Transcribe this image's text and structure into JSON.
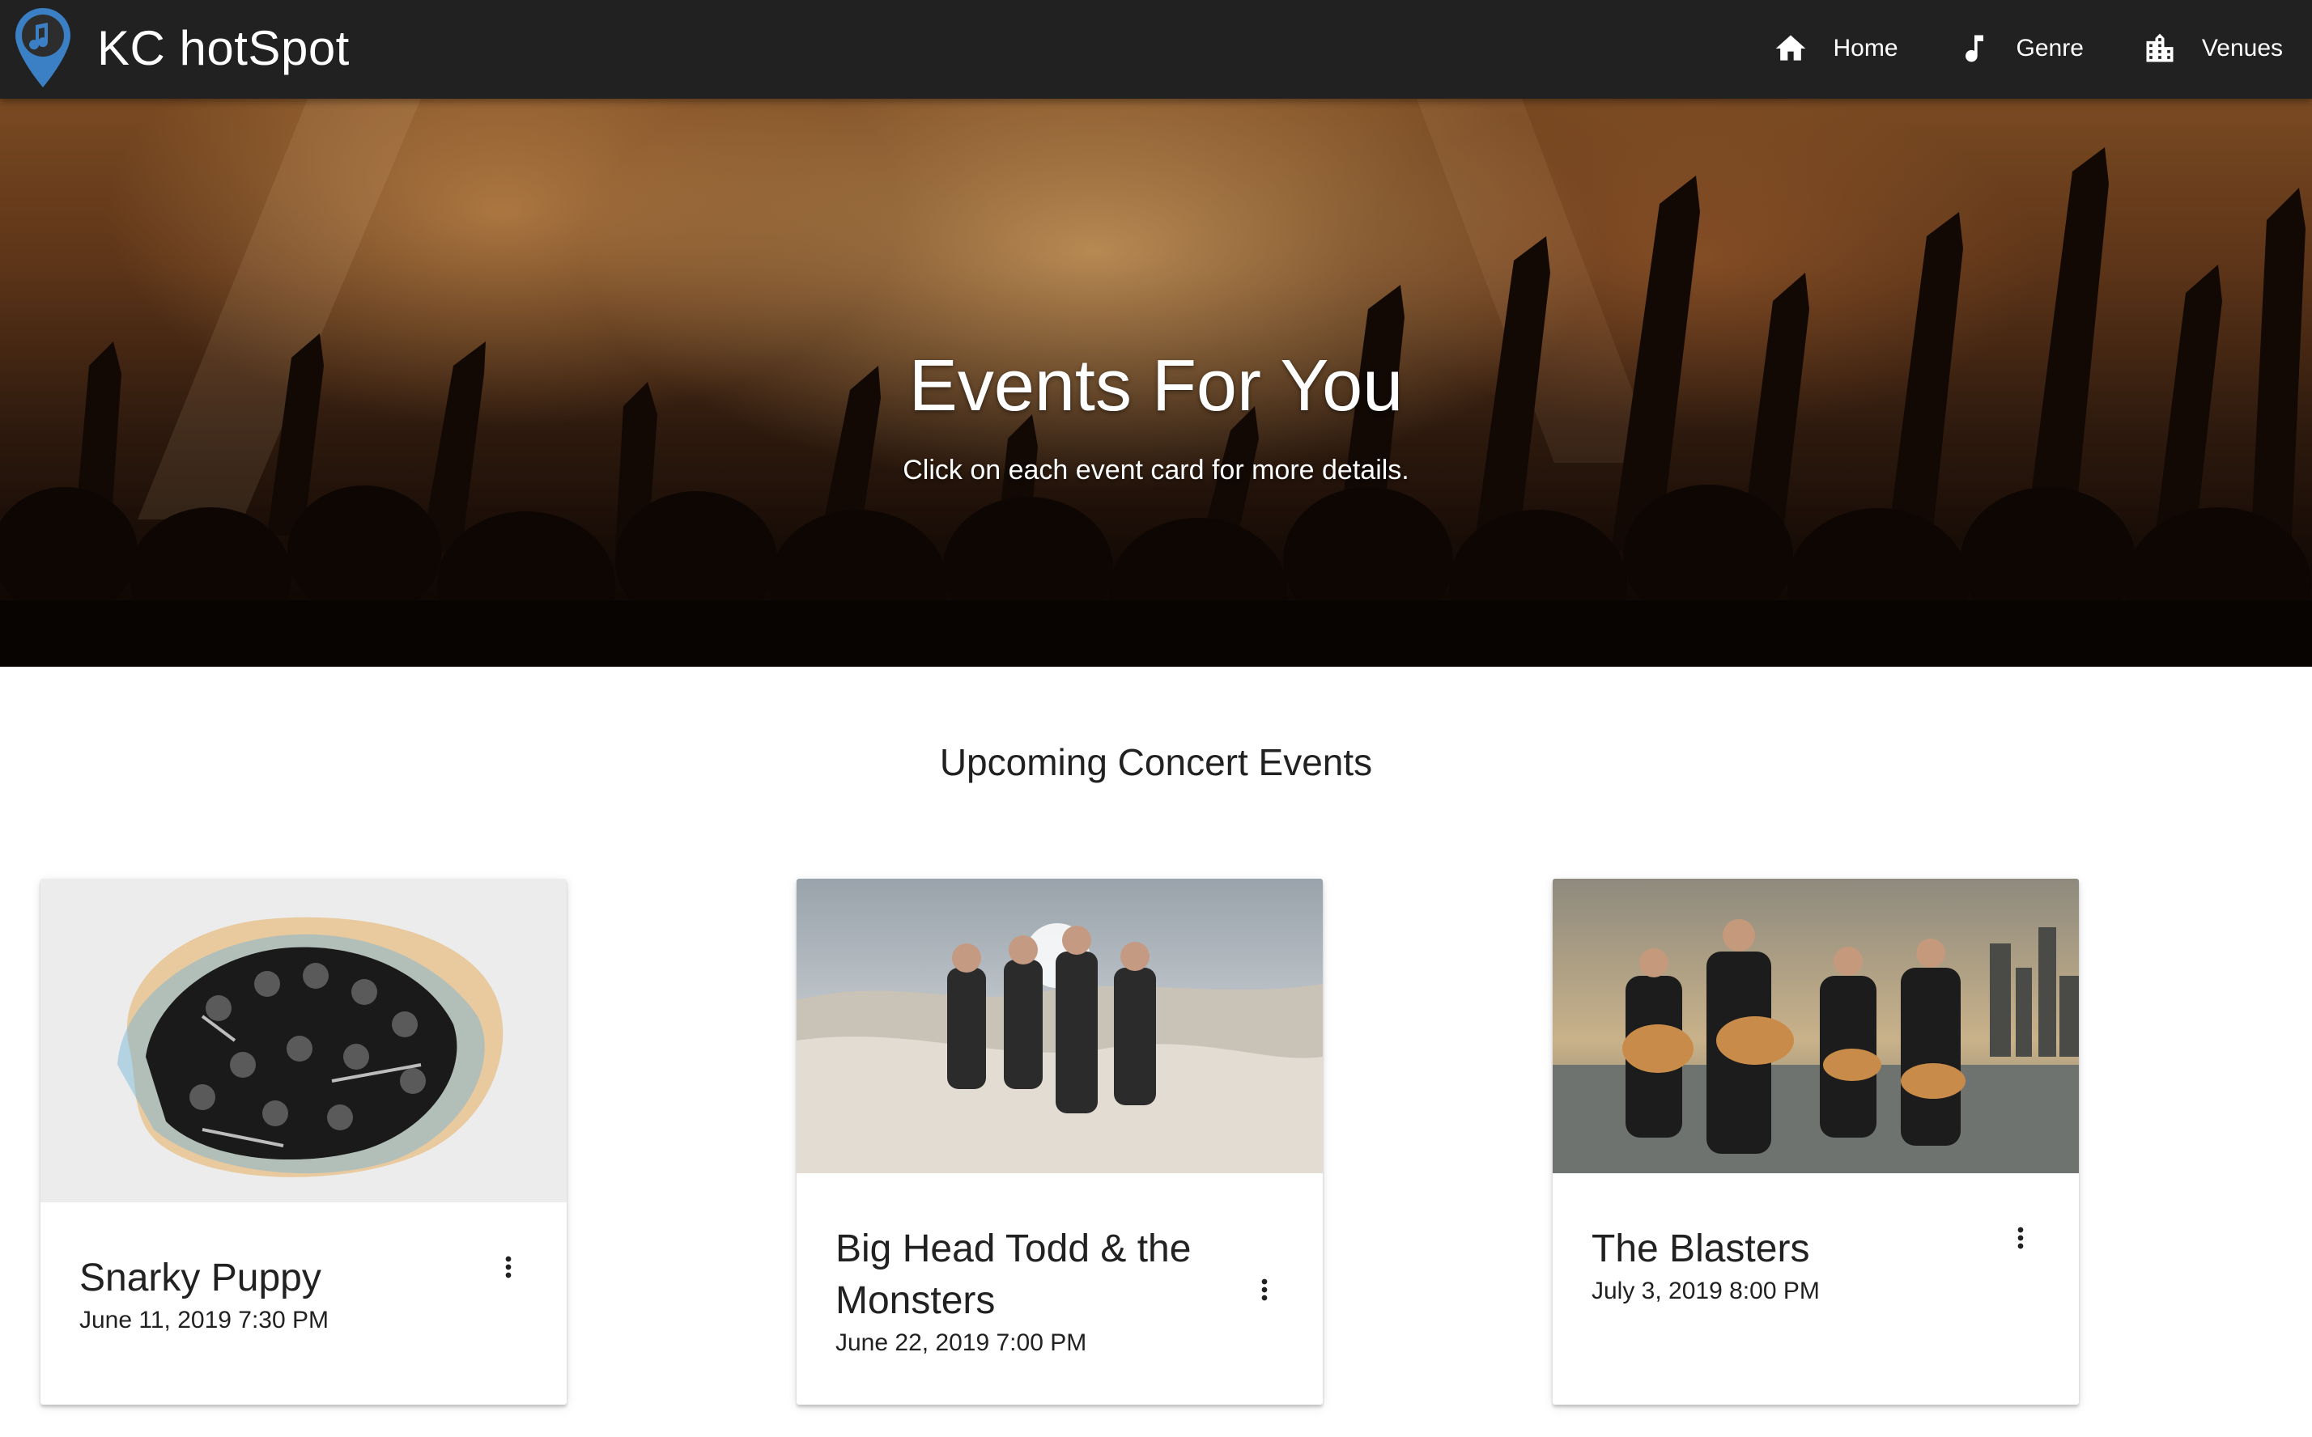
{
  "app": {
    "brand": "KC hotSpot",
    "colors": {
      "appbar": "#212121",
      "pin": "#3b7fc4",
      "text": "#212121"
    },
    "nav": [
      {
        "label": "Home",
        "icon": "home-icon"
      },
      {
        "label": "Genre",
        "icon": "music-note-icon"
      },
      {
        "label": "Venues",
        "icon": "city-building-icon"
      }
    ]
  },
  "hero": {
    "title": "Events For You",
    "subtitle": "Click on each event card for more details."
  },
  "section": {
    "title": "Upcoming Concert Events"
  },
  "events": [
    {
      "title": "Snarky Puppy",
      "date": "June 11, 2019 7:30 PM",
      "menu_icon": "more-vert-icon"
    },
    {
      "title": "Big Head Todd & the Monsters",
      "date": "June 22, 2019 7:00 PM",
      "menu_icon": "more-vert-icon"
    },
    {
      "title": "The Blasters",
      "date": "July 3, 2019 8:00 PM",
      "menu_icon": "more-vert-icon"
    }
  ]
}
